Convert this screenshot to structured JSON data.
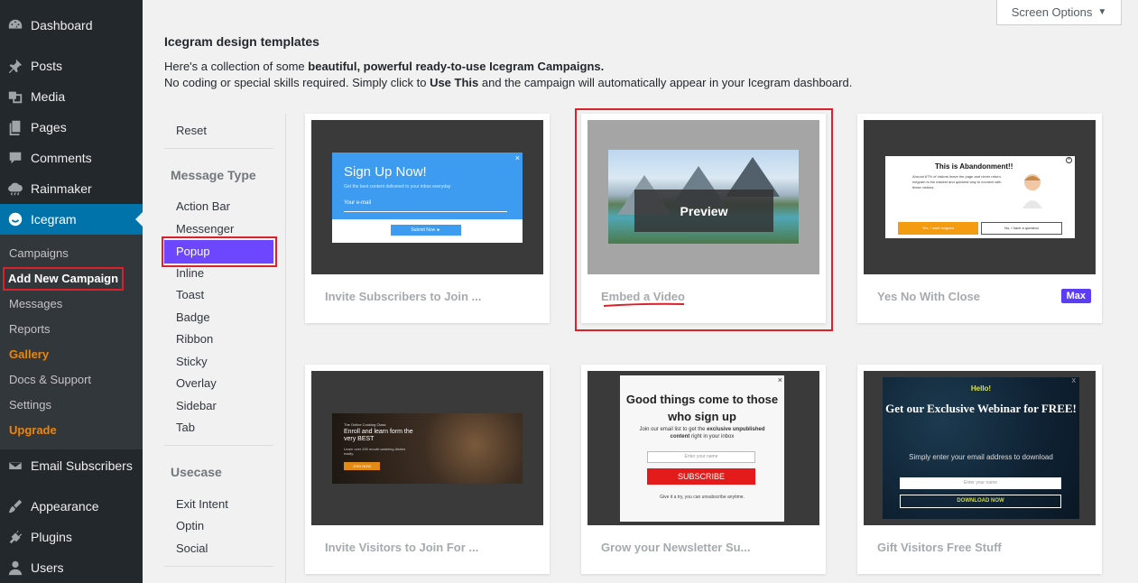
{
  "sidebar": {
    "items": [
      {
        "label": "Dashboard",
        "icon": "dashboard-icon"
      },
      {
        "label": "Posts",
        "icon": "pin-icon"
      },
      {
        "label": "Media",
        "icon": "media-icon"
      },
      {
        "label": "Pages",
        "icon": "pages-icon"
      },
      {
        "label": "Comments",
        "icon": "comment-icon"
      },
      {
        "label": "Rainmaker",
        "icon": "cloud-icon"
      },
      {
        "label": "Icegram",
        "icon": "icegram-icon"
      },
      {
        "label": "Email Subscribers",
        "icon": "envelope-icon"
      },
      {
        "label": "Appearance",
        "icon": "brush-icon"
      },
      {
        "label": "Plugins",
        "icon": "plug-icon"
      },
      {
        "label": "Users",
        "icon": "user-icon"
      }
    ],
    "submenu": [
      {
        "label": "Campaigns"
      },
      {
        "label": "Add New Campaign"
      },
      {
        "label": "Messages"
      },
      {
        "label": "Reports"
      },
      {
        "label": "Gallery"
      },
      {
        "label": "Docs & Support"
      },
      {
        "label": "Settings"
      },
      {
        "label": "Upgrade"
      }
    ]
  },
  "screen_options": {
    "label": "Screen Options"
  },
  "header": {
    "title": "Icegram design templates",
    "intro1_a": "Here's a collection of some ",
    "intro1_b": "beautiful, powerful ready-to-use Icegram Campaigns.",
    "intro2_a": "No coding or special skills required. Simply click to ",
    "intro2_b": "Use This",
    "intro2_c": " and the campaign will automatically appear in your Icegram dashboard."
  },
  "filters": {
    "reset": "Reset",
    "message_type_heading": "Message Type",
    "message_types": [
      "Action Bar",
      "Messenger",
      "Popup",
      "Inline",
      "Toast",
      "Badge",
      "Ribbon",
      "Sticky",
      "Overlay",
      "Sidebar",
      "Tab"
    ],
    "usecase_heading": "Usecase",
    "usecases": [
      "Exit Intent",
      "Optin",
      "Social"
    ]
  },
  "cards": [
    {
      "name": "Invite Subscribers to Join ...",
      "thumb": {
        "title": "Sign Up Now!",
        "sub": "Get the best content delivered to your inbox everyday",
        "field": "Your e-mail",
        "button": "Submit Now ►",
        "close": "×"
      }
    },
    {
      "name": "Embed a Video",
      "thumb": {
        "overlay": "Preview"
      }
    },
    {
      "name": "Yes No With Close",
      "badge": "Max",
      "thumb": {
        "title": "This is Abandonment!!",
        "text": "Around 67% of visitors leave the page and never return. Icegram is the easiest and quickest way to connect with these visitors.",
        "yes": "Yes, I want Icegram",
        "no": "No, I have a question"
      }
    },
    {
      "name": "Invite Visitors to Join For ...",
      "thumb": {
        "kicker": "The Online Cooking Class",
        "title": "Enroll and learn form the very BEST",
        "sub": "Learn over 200 mouth-watering dishes easily.",
        "button": "JOIN NOW"
      }
    },
    {
      "name": "Grow your Newsletter Su...",
      "thumb": {
        "heading": "Good things come to those who sign up",
        "text_a": "Join our email list to get the ",
        "text_b": "exclusive unpublished content",
        "text_c": " right in your inbox",
        "field": "Enter your name",
        "button": "SUBSCRIBE",
        "footer": "Give it a try, you can unsubscribe anytime.",
        "close": "×"
      }
    },
    {
      "name": "Gift Visitors Free Stuff",
      "thumb": {
        "hello": "Hello!",
        "heading": "Get our Exclusive Webinar for FREE!",
        "sub": "Simply enter your email address to download",
        "field": "Enter your name",
        "button": "DOWNLOAD NOW",
        "close": "X"
      }
    }
  ],
  "colors": {
    "accent": "#0073aa",
    "active_filter": "#6c47ff",
    "highlight": "#d9222a",
    "orange": "#f18500"
  }
}
